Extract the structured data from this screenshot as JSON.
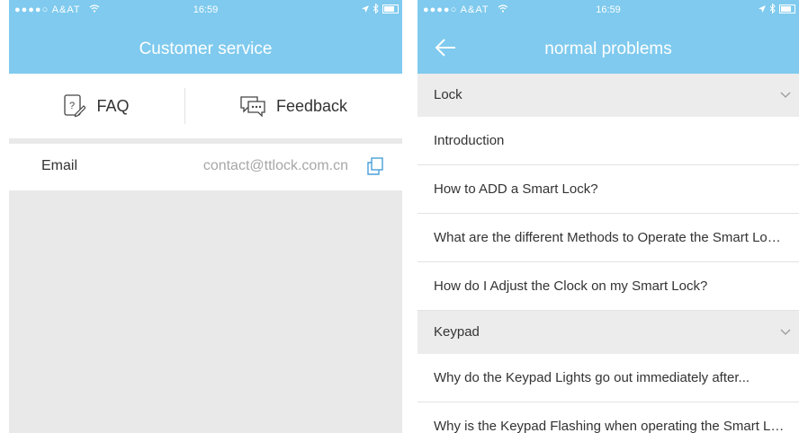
{
  "status_bar": {
    "carrier": "●●●●○ A&AT",
    "time": "16:59"
  },
  "left_screen": {
    "title": "Customer service",
    "faq_label": "FAQ",
    "feedback_label": "Feedback",
    "email_label": "Email",
    "email_value": "contact@ttlock.com.cn"
  },
  "right_screen": {
    "title": "normal problems",
    "sections": [
      {
        "label": "Lock",
        "items": [
          "Introduction",
          "How to ADD a Smart Lock?",
          "What are the different Methods to Operate the Smart Lock?",
          "How do I Adjust the Clock on my Smart Lock?"
        ]
      },
      {
        "label": "Keypad",
        "items": [
          "Why do the Keypad Lights go out immediately after...",
          "Why is the Keypad Flashing when operating the Smart Lock?"
        ]
      }
    ]
  },
  "colors": {
    "header": "#7fcaee",
    "icon_blue": "#4a9fd8"
  }
}
